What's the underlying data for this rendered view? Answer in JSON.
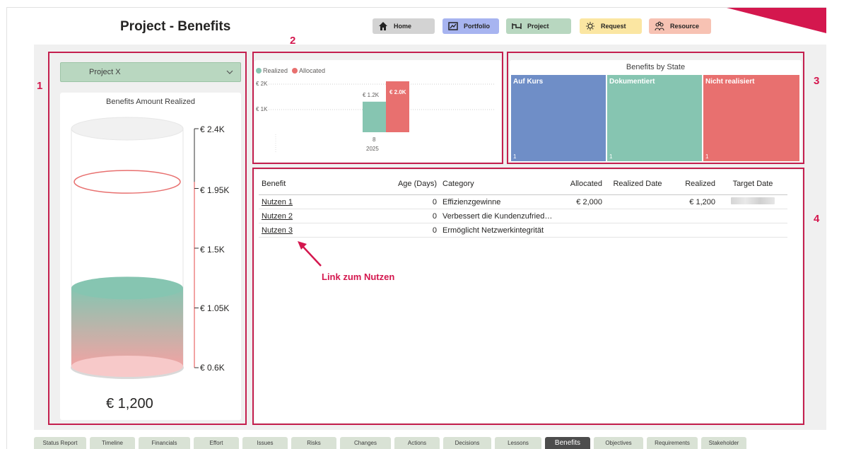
{
  "page": {
    "title": "Project - Benefits"
  },
  "nav": [
    {
      "label": "Home",
      "icon": "home-icon",
      "color": "#d3d3d3"
    },
    {
      "label": "Portfolio",
      "icon": "portfolio-icon",
      "color": "#a7b4f0"
    },
    {
      "label": "Project",
      "icon": "project-icon",
      "color": "#b8d7c0"
    },
    {
      "label": "Request",
      "icon": "lightbulb-icon",
      "color": "#fbe6a2"
    },
    {
      "label": "Resource",
      "icon": "people-icon",
      "color": "#f7c2b3"
    }
  ],
  "sections": [
    "1",
    "2",
    "3",
    "4"
  ],
  "filter": {
    "selected": "Project X"
  },
  "gauge": {
    "title": "Benefits Amount Realized",
    "ticks": [
      "€ 2.4K",
      "€ 1.95K",
      "€ 1.5K",
      "€ 1.05K",
      "€ 0.6K"
    ],
    "value_label": "€ 1,200",
    "value": 1200,
    "target": 2000,
    "min": 600,
    "max": 2400
  },
  "column_chart": {
    "legend": [
      "Realized",
      "Allocated"
    ],
    "y_ticks": [
      "€ 2K",
      "€ 1K"
    ],
    "x_label": "8",
    "x_sub_label": "2025",
    "data_labels": [
      "€ 1.2K",
      "€ 2.0K"
    ]
  },
  "chart_data": {
    "type": "bar",
    "categories": [
      "8 2025"
    ],
    "series": [
      {
        "name": "Realized",
        "values": [
          1200
        ],
        "color": "#86c5b1"
      },
      {
        "name": "Allocated",
        "values": [
          2000
        ],
        "color": "#e8706f"
      }
    ],
    "ylim": [
      0,
      2500
    ]
  },
  "treemap": {
    "title": "Benefits by State",
    "cells": [
      {
        "label": "Auf Kurs",
        "count": "1",
        "color": "#6f8ec7"
      },
      {
        "label": "Dokumentiert",
        "count": "1",
        "color": "#86c5b1"
      },
      {
        "label": "Nicht realisiert",
        "count": "1",
        "color": "#e8706f"
      }
    ]
  },
  "table": {
    "headers": [
      "Benefit",
      "Age (Days)",
      "Category",
      "Allocated",
      "Realized Date",
      "Realized",
      "Target Date"
    ],
    "rows": [
      {
        "benefit": "Nutzen 1",
        "age": "0",
        "category": "Effizienzgewinne",
        "allocated": "€ 2,000",
        "realized_date": "",
        "realized": "€ 1,200"
      },
      {
        "benefit": "Nutzen 2",
        "age": "0",
        "category": "Verbessert die Kundenzufried…",
        "allocated": "",
        "realized_date": "",
        "realized": ""
      },
      {
        "benefit": "Nutzen 3",
        "age": "0",
        "category": "Ermöglicht Netzwerkintegrität",
        "allocated": "",
        "realized_date": "",
        "realized": ""
      }
    ]
  },
  "annotation": "Link zum Nutzen",
  "tabs": [
    "Status Report",
    "Timeline",
    "Financials",
    "Effort",
    "Issues",
    "Risks",
    "Changes",
    "Actions",
    "Decisions",
    "Lessons",
    "Benefits",
    "Objectives",
    "Requirements",
    "Stakeholder"
  ],
  "active_tab": "Benefits",
  "colors": {
    "accent": "#d4174e",
    "realized": "#86c5b1",
    "allocated": "#e8706f"
  }
}
